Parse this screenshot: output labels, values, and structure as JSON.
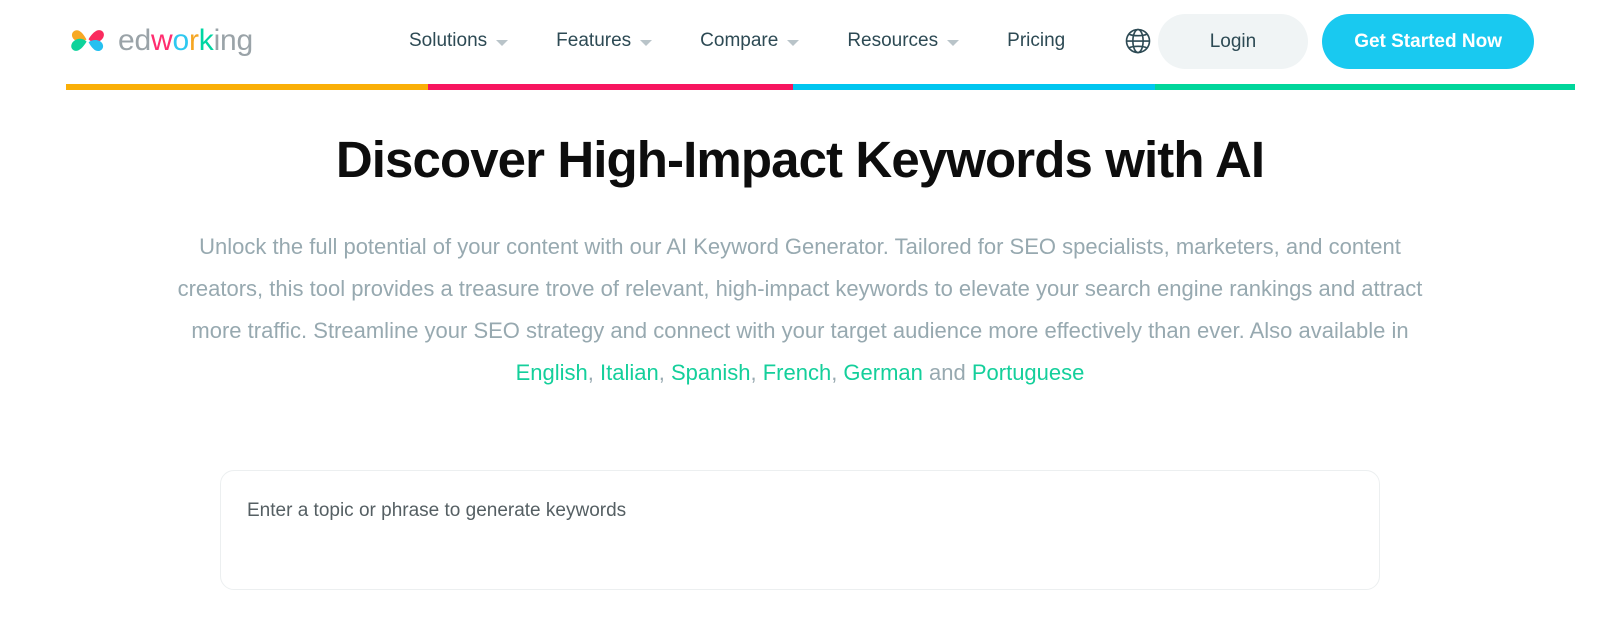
{
  "brand": {
    "logo_icon": "edworking-pinwheel-logo",
    "name_parts": [
      "ed",
      "w",
      "o",
      "r",
      "k",
      "ing"
    ],
    "name": "edworking"
  },
  "header": {
    "nav": [
      {
        "label": "Solutions",
        "has_dropdown": true
      },
      {
        "label": "Features",
        "has_dropdown": true
      },
      {
        "label": "Compare",
        "has_dropdown": true
      },
      {
        "label": "Resources",
        "has_dropdown": true
      },
      {
        "label": "Pricing",
        "has_dropdown": false
      }
    ],
    "language_icon": "globe-icon",
    "login_label": "Login",
    "cta_label": "Get Started Now"
  },
  "accent_bar": {
    "segments": [
      {
        "name": "orange",
        "color": "#FAAF07",
        "width_pct": 24.0
      },
      {
        "name": "pink",
        "color": "#F7155F",
        "width_pct": 24.2
      },
      {
        "name": "cyan",
        "color": "#00C6F0",
        "width_pct": 24.0
      },
      {
        "name": "green",
        "color": "#00D69B",
        "width_pct": 27.8
      }
    ]
  },
  "hero": {
    "title": "Discover High-Impact Keywords with AI",
    "paragraph_before": "Unlock the full potential of your content with our AI Keyword Generator. Tailored for SEO specialists, marketers, and content creators, this tool provides a treasure trove of relevant, high-impact keywords to elevate your search engine rankings and attract more traffic. Streamline your SEO strategy and connect with your target audience more effectively than ever. Also available in ",
    "languages": [
      "English",
      "Italian",
      "Spanish",
      "French",
      "German",
      "Portuguese"
    ],
    "paragraph_join": " and ",
    "language_link_color": "#14CF9B"
  },
  "tool": {
    "input_placeholder": "Enter a topic or phrase to generate keywords",
    "input_value": ""
  }
}
